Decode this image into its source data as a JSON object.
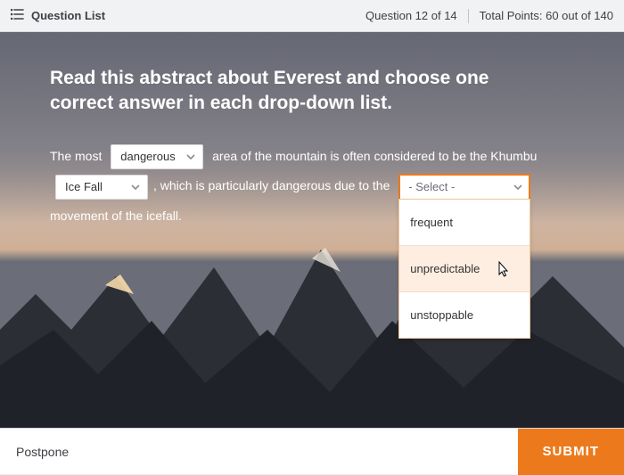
{
  "topbar": {
    "question_list_label": "Question List",
    "question_counter": "Question 12 of 14",
    "points": "Total Points: 60 out of 140"
  },
  "prompt": "Read this abstract about Everest and choose one correct answer in each drop-down list.",
  "passage": {
    "t1": "The most",
    "dd1_value": "dangerous",
    "t2": "area of the mountain is often",
    "t3": "considered to be the Khumbu",
    "dd2_value": "Ice Fall",
    "t4": ", which is",
    "t5": "particularly dangerous due to the",
    "dd3_placeholder": "- Select -",
    "t6": "movement of the icefall."
  },
  "dd3_options": {
    "o1": "frequent",
    "o2": "unpredictable",
    "o3": "unstoppable"
  },
  "footer": {
    "postpone": "Postpone",
    "submit": "SUBMIT"
  }
}
